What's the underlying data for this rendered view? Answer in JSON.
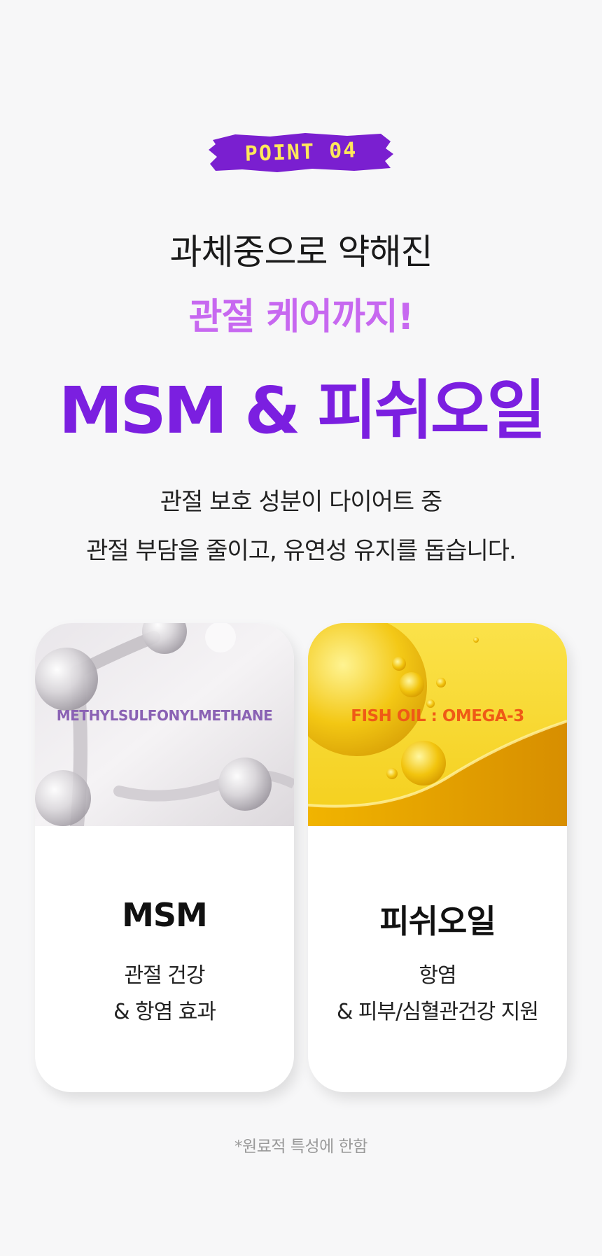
{
  "badge": {
    "label": "POINT 04",
    "color": "#7a1fd0",
    "text_color": "#ffe85a"
  },
  "headline": {
    "line1": "과체중으로 약해진",
    "line2": "관절 케어까지!",
    "line3": "MSM & 피쉬오일",
    "accent_light": "#c768f0",
    "accent_dark": "#7b1fe0"
  },
  "description": {
    "line1": "관절 보호 성분이 다이어트 중",
    "line2": "관절 부담을 줄이고, 유연성 유지를 돕습니다."
  },
  "cards": [
    {
      "image_label": "METHYLSULFONYLMETHANE",
      "image_icon": "molecule-illustration",
      "title": "MSM",
      "text_line1": "관절 건강",
      "text_line2": "& 항염 효과"
    },
    {
      "image_label": "FISH OIL : OMEGA-3",
      "image_icon": "oil-drops-illustration",
      "title": "피쉬오일",
      "text_line1": "항염",
      "text_line2": "& 피부/심혈관건강 지원"
    }
  ],
  "footnote": "*원료적 특성에 한함"
}
